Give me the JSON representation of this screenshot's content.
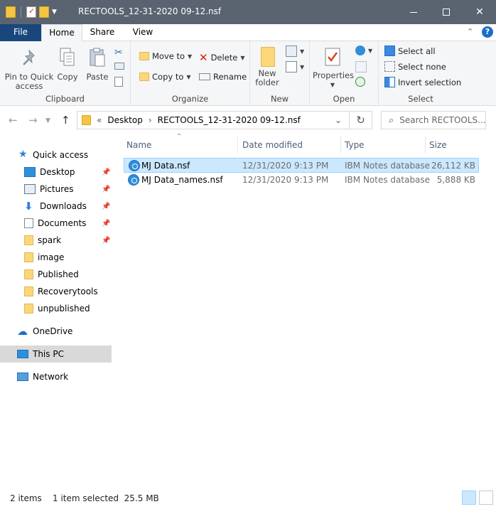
{
  "window": {
    "title": "RECTOOLS_12-31-2020 09-12.nsf"
  },
  "tabs": {
    "file": "File",
    "home": "Home",
    "share": "Share",
    "view": "View",
    "help": "?"
  },
  "ribbon": {
    "clipboard": {
      "label": "Clipboard",
      "pin": "Pin to Quick access",
      "copy": "Copy",
      "paste": "Paste"
    },
    "organize": {
      "label": "Organize",
      "move_to": "Move to",
      "copy_to": "Copy to",
      "delete": "Delete",
      "rename": "Rename"
    },
    "new": {
      "label": "New",
      "new_folder": "New folder"
    },
    "open": {
      "label": "Open",
      "properties": "Properties"
    },
    "select": {
      "label": "Select",
      "select_all": "Select all",
      "select_none": "Select none",
      "invert": "Invert selection"
    }
  },
  "address": {
    "chevrons": "«",
    "crumb1": "Desktop",
    "sep": "›",
    "crumb2": "RECTOOLS_12-31-2020 09-12.nsf",
    "search_placeholder": "Search RECTOOLS..."
  },
  "nav": {
    "quick_access": "Quick access",
    "items": [
      {
        "label": "Desktop"
      },
      {
        "label": "Pictures"
      },
      {
        "label": "Downloads"
      },
      {
        "label": "Documents"
      },
      {
        "label": "spark"
      },
      {
        "label": "image"
      },
      {
        "label": "Published"
      },
      {
        "label": "Recoverytools"
      },
      {
        "label": "unpublished"
      }
    ],
    "onedrive": "OneDrive",
    "this_pc": "This PC",
    "network": "Network"
  },
  "columns": {
    "name": "Name",
    "date": "Date modified",
    "type": "Type",
    "size": "Size"
  },
  "files": [
    {
      "name": "MJ Data.nsf",
      "date": "12/31/2020 9:13 PM",
      "type": "IBM Notes database",
      "size": "26,112 KB"
    },
    {
      "name": "MJ Data_names.nsf",
      "date": "12/31/2020 9:13 PM",
      "type": "IBM Notes database",
      "size": "5,888 KB"
    }
  ],
  "status": {
    "count": "2 items",
    "selection": "1 item selected  25.5 MB"
  },
  "colors": {
    "file_tab": "#19477d",
    "selection": "#cce8ff",
    "titlebar": "#5a6470"
  }
}
